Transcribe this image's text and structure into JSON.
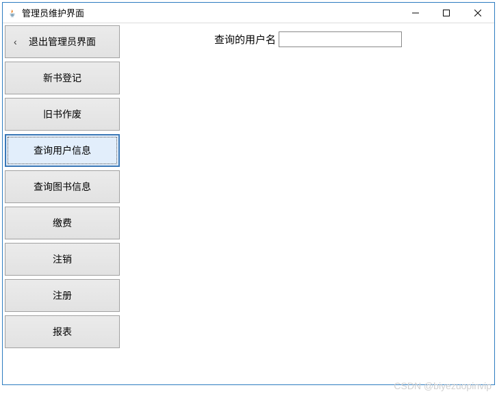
{
  "window": {
    "title": "管理员维护界面"
  },
  "sidebar": {
    "back_label": "退出管理员界面",
    "items": [
      {
        "label": "新书登记"
      },
      {
        "label": "旧书作废"
      },
      {
        "label": "查询用户信息",
        "active": true
      },
      {
        "label": "查询图书信息"
      },
      {
        "label": "缴费"
      },
      {
        "label": "注销"
      },
      {
        "label": "注册"
      },
      {
        "label": "报表"
      }
    ]
  },
  "main": {
    "query_label": "查询的用户名",
    "query_value": ""
  },
  "watermark": "CSDN @biyezuopinvip"
}
